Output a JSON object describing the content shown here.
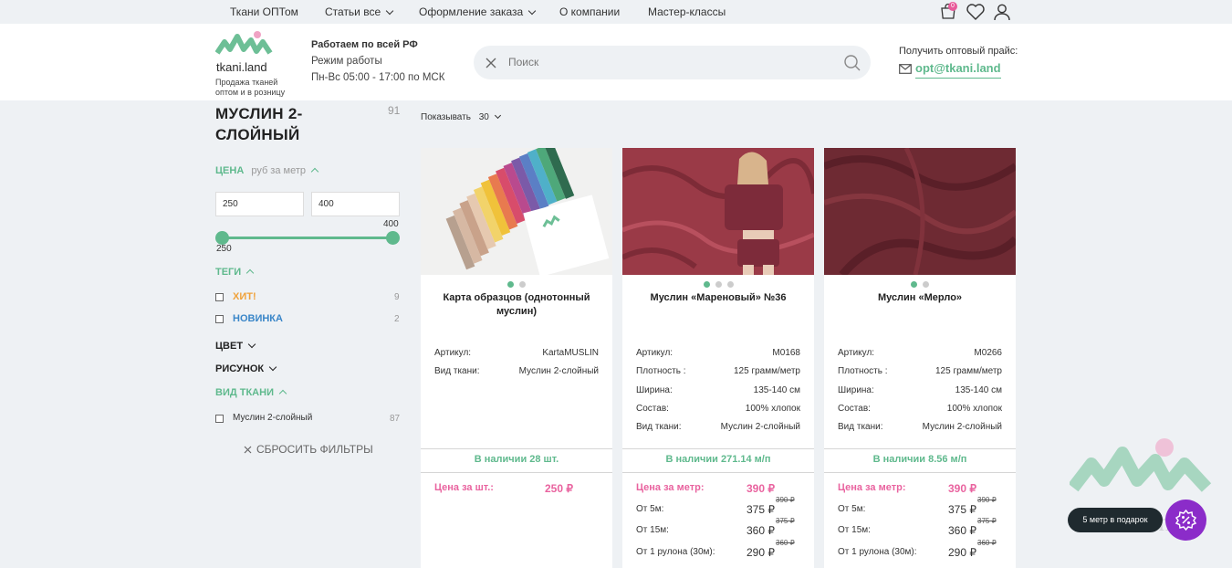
{
  "topnav": {
    "items": [
      {
        "label": "Ткани ОПТом",
        "dropdown": false
      },
      {
        "label": "Статьи все",
        "dropdown": true
      },
      {
        "label": "Оформление заказа",
        "dropdown": true
      },
      {
        "label": "О компании",
        "dropdown": false
      },
      {
        "label": "Мастер-классы",
        "dropdown": false
      }
    ],
    "cart_count": "0",
    "icons": [
      "cart-icon",
      "heart-icon",
      "user-icon"
    ]
  },
  "header": {
    "logo_name": "tkani.land",
    "logo_tagline": "Продажа тканей оптом и в розницу",
    "work_title": "Работаем по всей РФ",
    "work_mode": "Режим работы",
    "work_hours": "Пн-Вс 05:00 - 17:00 по МСК",
    "search_placeholder": "Поиск",
    "price_label": "Получить оптовый прайс:",
    "email": "opt@tkani.land"
  },
  "sidebar": {
    "title": "МУСЛИН 2-СЛОЙНЫЙ",
    "count": "91",
    "price_section": "ЦЕНА",
    "price_unit": "руб за метр",
    "price_from": "250",
    "price_to": "400",
    "slider_min": "250",
    "slider_max": "400",
    "tags_section": "ТЕГИ",
    "tags": [
      {
        "label": "ХИТ!",
        "count": "9",
        "color": "#f0a23a"
      },
      {
        "label": "НОВИНКА",
        "count": "2",
        "color": "#3a86c8"
      }
    ],
    "color_section": "ЦВЕТ",
    "pattern_section": "РИСУНОК",
    "fabric_section": "ВИД ТКАНИ",
    "fabric_options": [
      {
        "label": "Муслин 2-слойный",
        "count": "87"
      }
    ],
    "reset_label": "СБРОСИТЬ ФИЛЬТРЫ"
  },
  "toolbar": {
    "show_label": "Показывать",
    "show_value": "30"
  },
  "products": [
    {
      "title": "Карта образцов (однотонный муслин)",
      "dots": 2,
      "specs": [
        {
          "k": "Артикул:",
          "v": "KartaMUSLIN"
        },
        {
          "k": "Вид ткани:",
          "v": "Муслин 2-слойный"
        }
      ],
      "stock": "В наличии 28 шт.",
      "price_label": "Цена за шт.:",
      "price": "250 ₽",
      "tiers": []
    },
    {
      "title": "Муслин «Мареновый» №36",
      "dots": 3,
      "specs": [
        {
          "k": "Артикул:",
          "v": "M0168"
        },
        {
          "k": "Плотность :",
          "v": "125 грамм/метр"
        },
        {
          "k": "Ширина:",
          "v": "135-140 см"
        },
        {
          "k": "Состав:",
          "v": "100% хлопок"
        },
        {
          "k": "Вид ткани:",
          "v": "Муслин 2-слойный"
        }
      ],
      "stock": "В наличии 271.14 м/п",
      "price_label": "Цена за метр:",
      "price": "390 ₽",
      "tiers": [
        {
          "label": "От 5м:",
          "price": "375 ₽",
          "old": "390 ₽"
        },
        {
          "label": "От 15м:",
          "price": "360 ₽",
          "old": "375 ₽"
        },
        {
          "label": "От 1 рулона (30м):",
          "price": "290 ₽",
          "old": "360 ₽"
        }
      ]
    },
    {
      "title": "Муслин «Мерло»",
      "dots": 2,
      "specs": [
        {
          "k": "Артикул:",
          "v": "M0266"
        },
        {
          "k": "Плотность :",
          "v": "125 грамм/метр"
        },
        {
          "k": "Ширина:",
          "v": "135-140 см"
        },
        {
          "k": "Состав:",
          "v": "100% хлопок"
        },
        {
          "k": "Вид ткани:",
          "v": "Муслин 2-слойный"
        }
      ],
      "stock": "В наличии 8.56 м/п",
      "price_label": "Цена за метр:",
      "price": "390 ₽",
      "tiers": [
        {
          "label": "От 5м:",
          "price": "375 ₽",
          "old": "390 ₽"
        },
        {
          "label": "От 15м:",
          "price": "360 ₽",
          "old": "375 ₽"
        },
        {
          "label": "От 1 рулона (30м):",
          "price": "290 ₽",
          "old": "360 ₽"
        }
      ]
    }
  ],
  "promo": {
    "pill_text": "5 метр в подарок",
    "watermark": "tkani.land"
  },
  "colors": {
    "accent_green": "#5fb98d",
    "price_pink": "#e9639f",
    "promo_purple": "#8b2cc9"
  }
}
